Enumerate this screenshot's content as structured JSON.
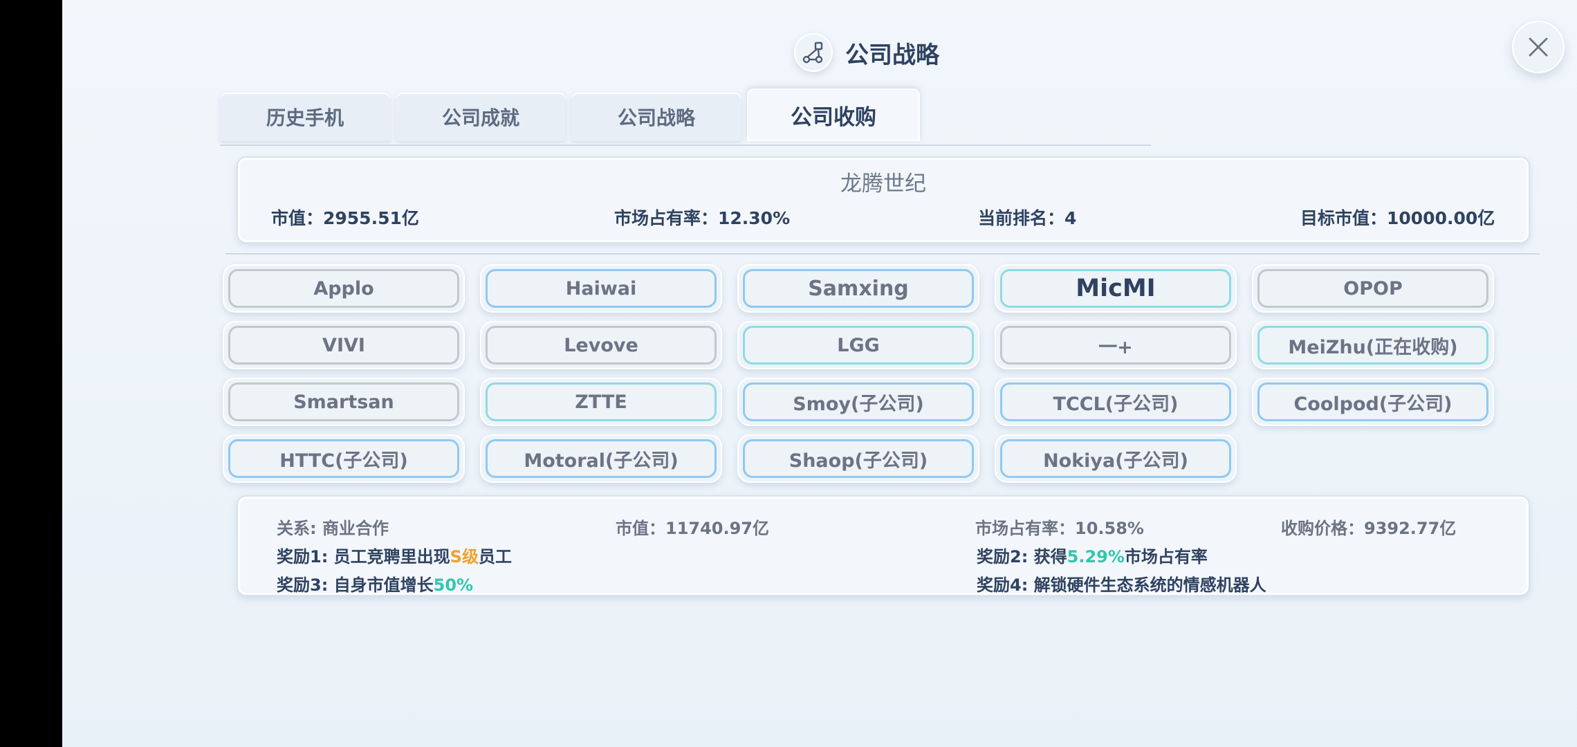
{
  "header": {
    "title": "公司战略",
    "icon": "network-icon"
  },
  "close": {
    "icon": "close-icon"
  },
  "tabs": [
    {
      "label": "历史手机",
      "active": false
    },
    {
      "label": "公司成就",
      "active": false
    },
    {
      "label": "公司战略",
      "active": false
    },
    {
      "label": "公司收购",
      "active": true
    }
  ],
  "company": {
    "name": "龙腾世纪",
    "market_value": "市值：2955.51亿",
    "market_share": "市场占有率：12.30%",
    "rank": "当前排名：4",
    "target": "目标市值：10000.00亿"
  },
  "companies": [
    {
      "label": "Applo",
      "border": "gray"
    },
    {
      "label": "Haiwai",
      "border": "blue"
    },
    {
      "label": "Samxing",
      "border": "blue"
    },
    {
      "label": "MicMI",
      "border": "teal"
    },
    {
      "label": "OPOP",
      "border": "gray"
    },
    {
      "label": "VIVI",
      "border": "gray"
    },
    {
      "label": "Levove",
      "border": "gray"
    },
    {
      "label": "LGG",
      "border": "teal"
    },
    {
      "label": "一+",
      "border": "gray"
    },
    {
      "label": "MeiZhu(正在收购)",
      "border": "teal"
    },
    {
      "label": "Smartsan",
      "border": "gray"
    },
    {
      "label": "ZTTE",
      "border": "teal"
    },
    {
      "label": "Smoy(子公司)",
      "border": "blue"
    },
    {
      "label": "TCCL(子公司)",
      "border": "blue"
    },
    {
      "label": "Coolpod(子公司)",
      "border": "blue"
    },
    {
      "label": "HTTC(子公司)",
      "border": "blue"
    },
    {
      "label": "Motoral(子公司)",
      "border": "blue"
    },
    {
      "label": "Shaop(子公司)",
      "border": "blue"
    },
    {
      "label": "Nokiya(子公司)",
      "border": "blue"
    }
  ],
  "selected_company": "MicMI",
  "details": {
    "relation": "关系: 商业合作",
    "market_value": "市值：11740.97亿",
    "market_share": "市场占有率：10.58%",
    "price": "收购价格：9392.77亿",
    "reward1_prefix": "奖励1: 员工竞聘里出现",
    "reward1_highlight": "S级",
    "reward1_suffix": "员工",
    "reward2_prefix": "奖励2: 获得",
    "reward2_highlight": "5.29%",
    "reward2_suffix": "市场占有率",
    "reward3_prefix": "奖励3: 自身市值增长",
    "reward3_highlight": "50%",
    "reward4": "奖励4: 解锁硬件生态系统的情感机器人"
  },
  "colors": {
    "title": "#2f4261",
    "orange_highlight": "#f0a030",
    "green_highlight": "#2fc7b0",
    "teal_border": "#8fdbe2",
    "blue_border": "#8ecaf0",
    "gray_border": "#c4c7cb"
  }
}
